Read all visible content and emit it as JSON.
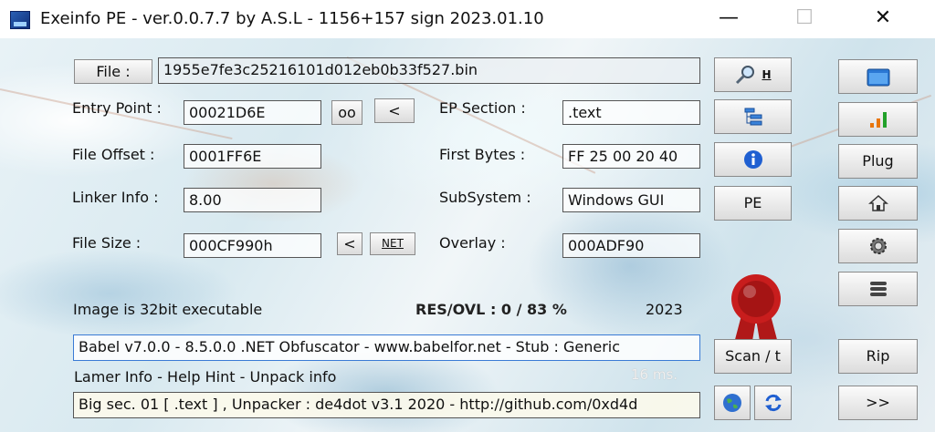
{
  "window": {
    "title": "Exeinfo PE - ver.0.0.7.7  by A.S.L -  1156+157 sign  2023.01.10",
    "minimize_glyph": "—",
    "maximize_glyph": "☐",
    "close_glyph": "✕"
  },
  "file": {
    "button_label": "File :",
    "name": "1955e7fe3c25216101d012eb0b33f527.bin"
  },
  "entry_point": {
    "label": "Entry Point :",
    "value": "00021D6E",
    "oo_label": "oo",
    "back_label": "<"
  },
  "ep_section": {
    "label": "EP Section :",
    "value": ".text"
  },
  "file_offset": {
    "label": "File Offset :",
    "value": "0001FF6E"
  },
  "first_bytes": {
    "label": "First Bytes :",
    "value": "FF 25 00 20 40"
  },
  "linker_info": {
    "label": "Linker Info :",
    "value": "8.00"
  },
  "subsystem": {
    "label": "SubSystem :",
    "value": "Windows GUI"
  },
  "file_size": {
    "label": "File Size :",
    "value": "000CF990h",
    "back_label": "<",
    "net_label": "NET"
  },
  "overlay": {
    "label": "Overlay :",
    "value": "000ADF90"
  },
  "status": {
    "image_info": "Image is 32bit executable",
    "res_ovl": "RES/OVL : 0 / 83 %",
    "year": "2023"
  },
  "detection": "Babel v7.0.0 - 8.5.0.0 .NET Obfuscator - www.babelfor.net - Stub : Generic",
  "lamer_info_label": "Lamer Info - Help Hint - Unpack info",
  "timing": "16 ms.",
  "hint": "Big sec. 01 [ .text ] , Unpacker : de4dot v3.1 2020 - http://github.com/0xd4d",
  "buttons": {
    "search_h": "H",
    "pe": "PE",
    "scan": "Scan / t",
    "plug": "Plug",
    "rip": "Rip",
    "next": ">>"
  },
  "colors": {
    "accent_blue": "#1f5fd1",
    "seal_red": "#c81d1d",
    "bar_orange": "#e8750a",
    "bar_green": "#22a12a"
  }
}
